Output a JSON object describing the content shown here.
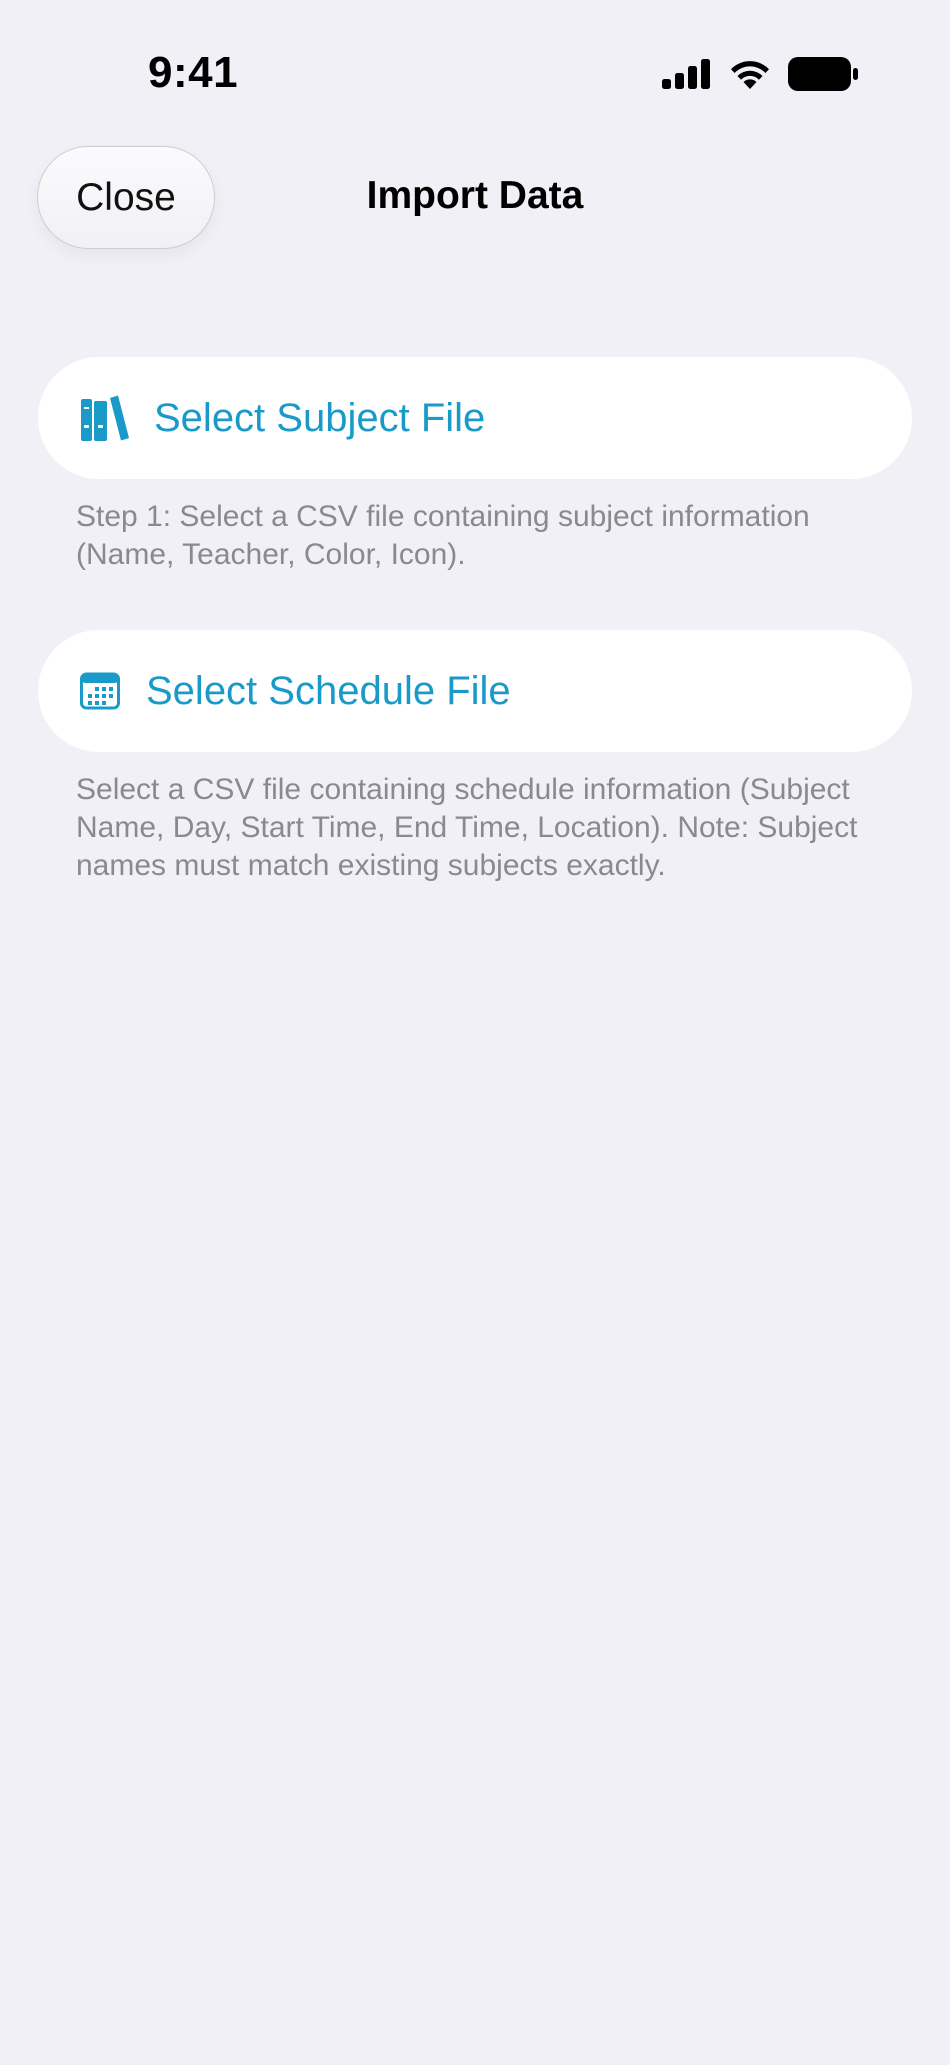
{
  "status_bar": {
    "time": "9:41",
    "icons": [
      "signal-icon",
      "wifi-icon",
      "battery-icon"
    ]
  },
  "nav": {
    "close_label": "Close",
    "title": "Import Data"
  },
  "subject_import": {
    "icon": "books-icon",
    "label": "Select Subject File",
    "help": "Step 1: Select a CSV file containing subject information (Name, Teacher, Color, Icon)."
  },
  "schedule_import": {
    "icon": "calendar-icon",
    "label": "Select Schedule File",
    "help": "Select a CSV file containing schedule information (Subject Name, Day, Start Time, End Time, Location). Note: Subject names must match existing subjects exactly."
  },
  "colors": {
    "accent": "#1a9ac8",
    "background": "#f1f0f6",
    "help_text": "#8a8a8e"
  }
}
